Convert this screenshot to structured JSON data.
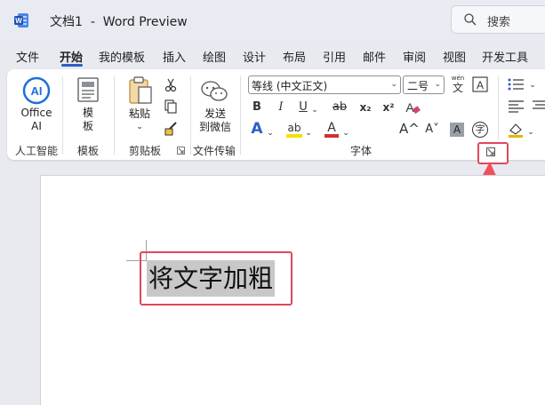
{
  "titlebar": {
    "document_name": "文档1",
    "separator": "-",
    "app_name": "Word Preview",
    "search_label": "搜索"
  },
  "tabs": [
    "文件",
    "开始",
    "我的模板",
    "插入",
    "绘图",
    "设计",
    "布局",
    "引用",
    "邮件",
    "审阅",
    "视图",
    "开发工具"
  ],
  "active_tab": "开始",
  "ribbon": {
    "ai": {
      "label_line1": "Office",
      "label_line2": "AI",
      "group_label": "人工智能"
    },
    "template": {
      "label_line1": "模",
      "label_line2": "板",
      "group_label": "模板"
    },
    "clipboard": {
      "paste_label": "粘贴",
      "group_label": "剪贴板"
    },
    "file_transfer": {
      "label_line1": "发送",
      "label_line2": "到微信",
      "group_label": "文件传输"
    },
    "font": {
      "font_name": "等线 (中文正文)",
      "font_size": "二号",
      "phonetic_top": "wén",
      "phonetic_bottom": "文",
      "bold": "B",
      "italic": "I",
      "underline": "U",
      "strikethrough": "ab",
      "subscript": "x₂",
      "superscript": "x²",
      "text_effect": "A",
      "highlight": "ab",
      "font_color": "A",
      "grow_font": "A^",
      "shrink_font": "A˅",
      "char_shading": "A",
      "enclose": "字",
      "group_label": "字体"
    }
  },
  "document": {
    "text": "将文字加粗"
  },
  "colors": {
    "accent_blue": "#2b5fc4",
    "highlight_red": "#e0485a",
    "selection_gray": "#c8c8c8",
    "highlight_yellow": "#f5e000",
    "font_red": "#d32f2f"
  }
}
